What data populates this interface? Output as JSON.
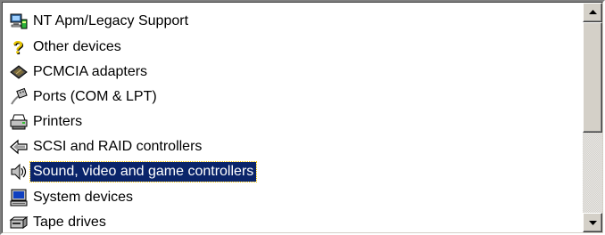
{
  "tree": {
    "items": [
      {
        "label": "NT Apm/Legacy Support",
        "icon": "apm-legacy-icon"
      },
      {
        "label": "Other devices",
        "icon": "question-mark-icon"
      },
      {
        "label": "PCMCIA adapters",
        "icon": "pcmcia-card-icon"
      },
      {
        "label": "Ports (COM & LPT)",
        "icon": "port-connector-icon"
      },
      {
        "label": "Printers",
        "icon": "printer-icon"
      },
      {
        "label": "SCSI and RAID controllers",
        "icon": "scsi-controller-icon"
      },
      {
        "label": "Sound, video and game controllers",
        "icon": "speaker-icon",
        "selected": true
      },
      {
        "label": "System devices",
        "icon": "computer-icon"
      },
      {
        "label": "Tape drives",
        "icon": "tape-drive-icon"
      }
    ]
  },
  "colors": {
    "selection_bg": "#0a246a",
    "selection_text": "#ffffff",
    "window_bg": "#ffffff",
    "chrome": "#d4d0c8"
  }
}
